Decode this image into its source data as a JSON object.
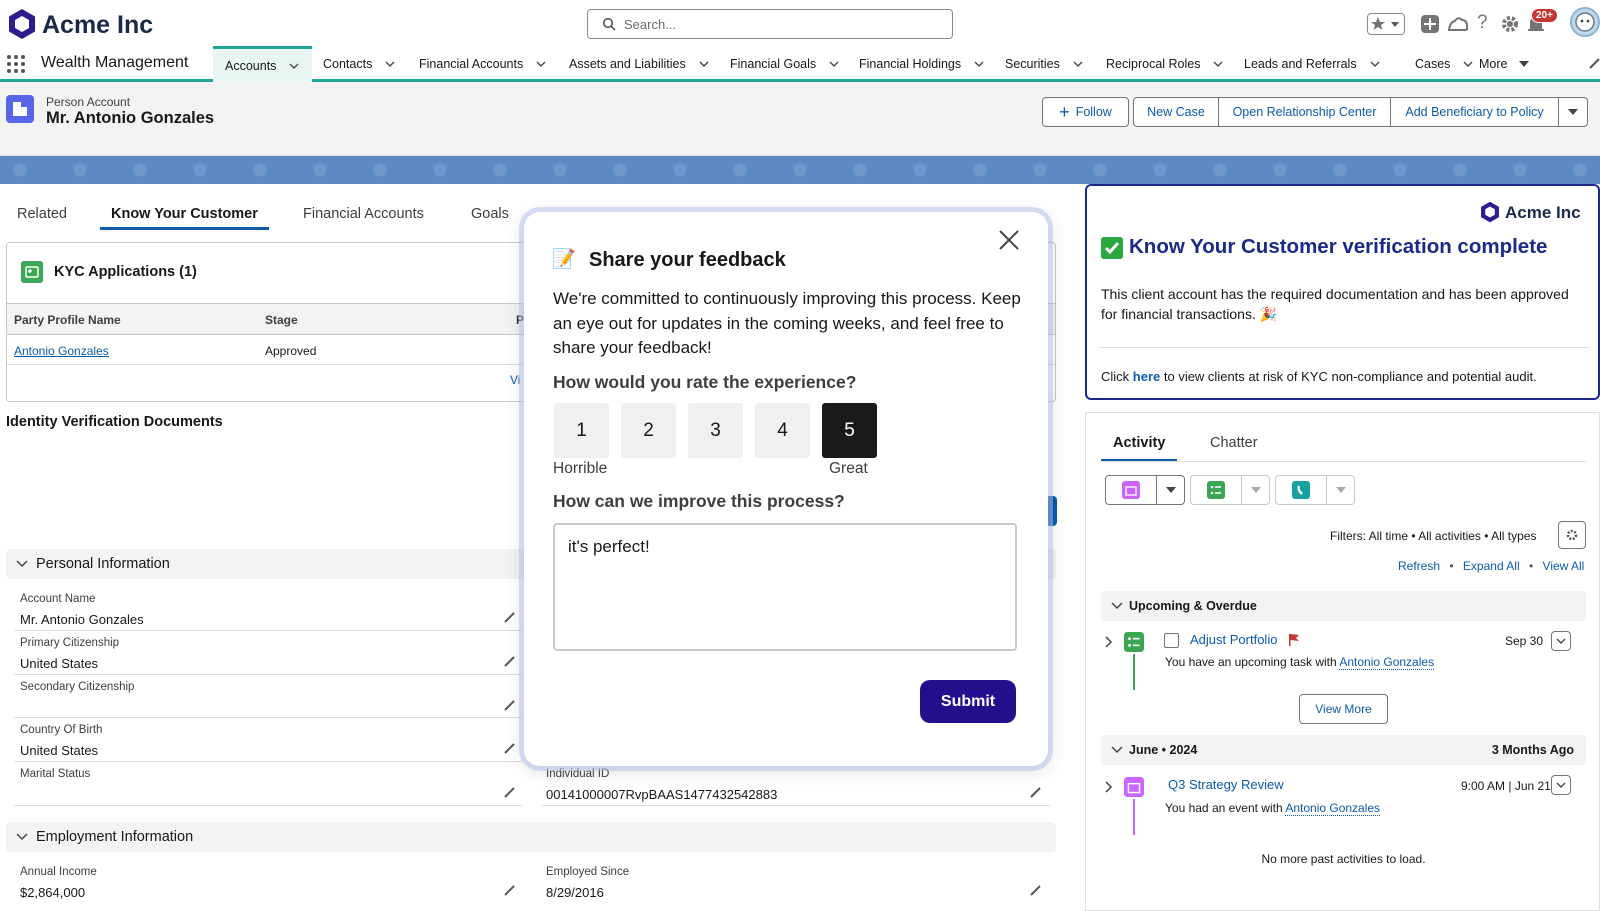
{
  "app": {
    "brand": "Acme Inc",
    "name": "Wealth Management"
  },
  "search": {
    "placeholder": "Search..."
  },
  "notifications": {
    "badge": "20+"
  },
  "nav": {
    "items": [
      {
        "label": "Accounts",
        "active": true
      },
      {
        "label": "Contacts"
      },
      {
        "label": "Financial Accounts"
      },
      {
        "label": "Assets and Liabilities"
      },
      {
        "label": "Financial Goals"
      },
      {
        "label": "Financial Holdings"
      },
      {
        "label": "Securities"
      },
      {
        "label": "Reciprocal Roles"
      },
      {
        "label": "Leads and Referrals"
      },
      {
        "label": "Cases"
      },
      {
        "label": "More"
      }
    ]
  },
  "record": {
    "type": "Person Account",
    "name": "Mr. Antonio Gonzales",
    "actions": {
      "follow": "Follow",
      "new_case": "New Case",
      "open_rc": "Open Relationship Center",
      "add_beneficiary": "Add Beneficiary to Policy"
    }
  },
  "tabs": [
    "Related",
    "Know Your Customer",
    "Financial Accounts",
    "Goals"
  ],
  "kyc": {
    "title": "KYC Applications (1)",
    "headers": [
      "Party Profile Name",
      "Stage",
      "P"
    ],
    "rows": [
      {
        "name": "Antonio Gonzales",
        "stage": "Approved"
      }
    ],
    "view_all": "Vi"
  },
  "identity": {
    "title": "Identity Verification Documents"
  },
  "personal": {
    "title": "Personal Information",
    "fields": [
      {
        "label": "Account Name",
        "value": "Mr. Antonio Gonzales"
      },
      {
        "label": "Primary Citizenship",
        "value": "United States"
      },
      {
        "label": "Secondary Citizenship",
        "value": ""
      },
      {
        "label": "Country Of Birth",
        "value": "United States"
      },
      {
        "label": "Marital Status",
        "value": ""
      }
    ],
    "right_fields": [
      {
        "label": "Individual ID",
        "value": "00141000007RvpBAAS1477432542883"
      }
    ]
  },
  "employment": {
    "title": "Employment Information",
    "fields": [
      {
        "label": "Annual Income",
        "value": "$2,864,000"
      },
      {
        "label": "Employed Since",
        "value": "8/29/2016"
      }
    ]
  },
  "kyc_complete": {
    "brand": "Acme Inc",
    "title": "Know Your Customer verification complete",
    "body": "This client account has the required documentation and has been approved for financial transactions. 🎉",
    "click": "Click ",
    "here": "here",
    "rest": " to view clients at risk of KYC non-compliance and potential audit."
  },
  "activity": {
    "tabs": [
      "Activity",
      "Chatter"
    ],
    "filters": "Filters: All time • All activities • All types",
    "links": [
      "Refresh",
      "Expand All",
      "View All"
    ],
    "upcoming": {
      "title": "Upcoming & Overdue",
      "task": "Adjust Portfolio",
      "date": "Sep 30",
      "desc": "You have an upcoming task with ",
      "who": "Antonio Gonzales",
      "view_more": "View More"
    },
    "month": {
      "title": "June • 2024",
      "ago": "3 Months Ago",
      "event": "Q3 Strategy Review",
      "time": "9:00 AM | Jun 21",
      "desc": "You had an event with ",
      "who": "Antonio Gonzales"
    },
    "no_more": "No more past activities to load."
  },
  "modal": {
    "emoji": "📝",
    "title": "Share your feedback",
    "body": "We're committed to continuously improving this process. Keep an eye out for updates in the coming weeks, and feel free to share your feedback!",
    "rate_q": "How would you rate the experience?",
    "ratings": [
      "1",
      "2",
      "3",
      "4",
      "5"
    ],
    "selected": 5,
    "low": "Horrible",
    "high": "Great",
    "improve_q": "How can we improve this process?",
    "answer": "it's perfect!",
    "submit": "Submit"
  }
}
